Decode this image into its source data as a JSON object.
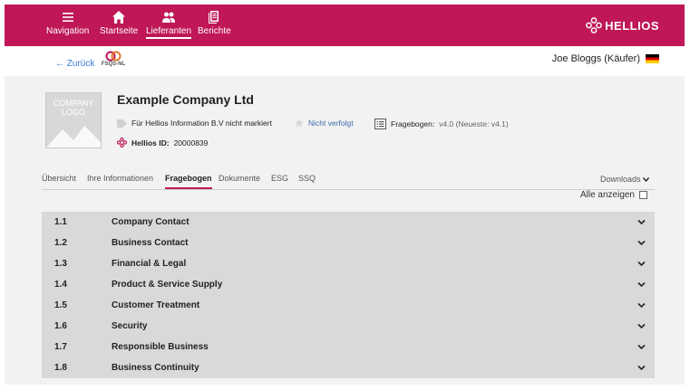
{
  "nav": {
    "items": [
      {
        "label": "Navigation",
        "icon": "hamburger-icon"
      },
      {
        "label": "Startseite",
        "icon": "home-icon"
      },
      {
        "label": "Lieferanten",
        "icon": "people-icon"
      },
      {
        "label": "Berichte",
        "icon": "report-icon"
      }
    ],
    "active_index": 2,
    "brand": "HELLIOS"
  },
  "subheader": {
    "back_label": "← Zurück",
    "fsqs_label": "FSQS-NL",
    "user": "Joe Bloggs  (Käufer)"
  },
  "company": {
    "logo_text": "COMPANY LOGO",
    "name": "Example Company Ltd",
    "tag_label": "Für Hellios Information B.V nicht markiert",
    "follow_label": "Nicht verfolgt",
    "questionnaire_label": "Fragebogen:",
    "questionnaire_value": "v4.0 (Neueste: v4.1)",
    "hellios_id_label": "Hellios ID:",
    "hellios_id_value": "20000839"
  },
  "tabs": [
    {
      "label": "Übersicht"
    },
    {
      "label": "Ihre Informationen"
    },
    {
      "label": "Fragebogen"
    },
    {
      "label": "Dokumente"
    },
    {
      "label": "ESG"
    },
    {
      "label": "SSQ"
    }
  ],
  "active_tab": 2,
  "downloads_label": "Downloads",
  "show_all_label": "Alle anzeigen",
  "sections": [
    {
      "num": "1.1",
      "title": "Company Contact"
    },
    {
      "num": "1.2",
      "title": "Business Contact"
    },
    {
      "num": "1.3",
      "title": "Financial & Legal"
    },
    {
      "num": "1.4",
      "title": "Product & Service Supply"
    },
    {
      "num": "1.5",
      "title": "Customer Treatment"
    },
    {
      "num": "1.6",
      "title": "Security"
    },
    {
      "num": "1.7",
      "title": "Responsible Business"
    },
    {
      "num": "1.8",
      "title": "Business Continuity"
    }
  ],
  "colors": {
    "brand": "#bf1757",
    "link": "#3a7ad9"
  }
}
